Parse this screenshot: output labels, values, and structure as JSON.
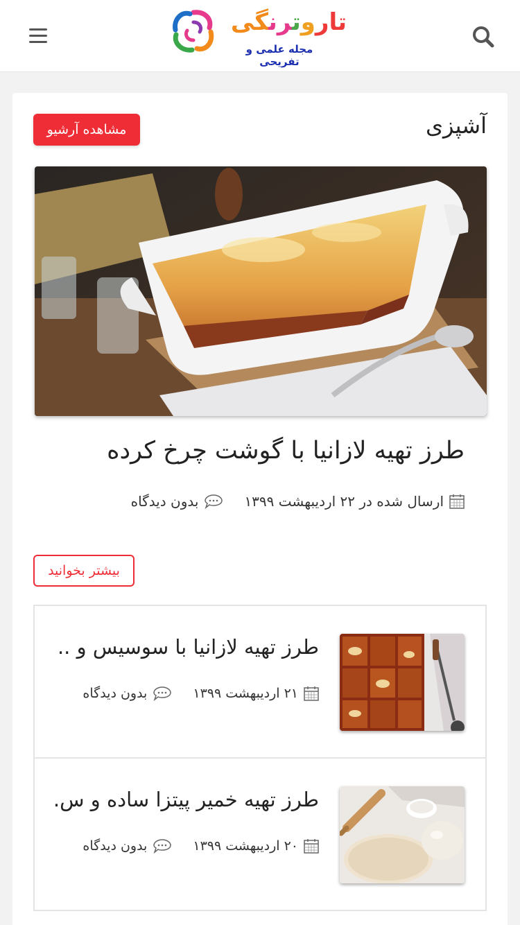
{
  "header": {
    "logo_title": "تاروت رنگی",
    "logo_subtitle": "مجله علمی و تفریحی"
  },
  "section": {
    "title": "آشپزی",
    "archive_label": "مشاهده آرشیو"
  },
  "featured": {
    "title": "طرز تهیه لازانیا با گوشت چرخ کرده",
    "date": "ارسال شده در ۲۲ اردیبهشت ۱۳۹۹",
    "comments": "بدون دیدگاه",
    "read_more_label": "بیشتر بخوانید"
  },
  "posts": [
    {
      "title": "طرز تهیه لازانیا با سوسیس و ...",
      "date": "۲۱ اردیبهشت ۱۳۹۹",
      "comments": "بدون دیدگاه"
    },
    {
      "title": "طرز تهیه خمیر پیتزا ساده و س...",
      "date": "۲۰ اردیبهشت ۱۳۹۹",
      "comments": "بدون دیدگاه"
    }
  ],
  "icons": {
    "menu": "hamburger-icon",
    "search": "search-icon",
    "calendar": "calendar-icon",
    "comment": "comment-icon"
  },
  "colors": {
    "accent_red": "#ef2d36",
    "subtitle_blue": "#1c2fb0"
  }
}
